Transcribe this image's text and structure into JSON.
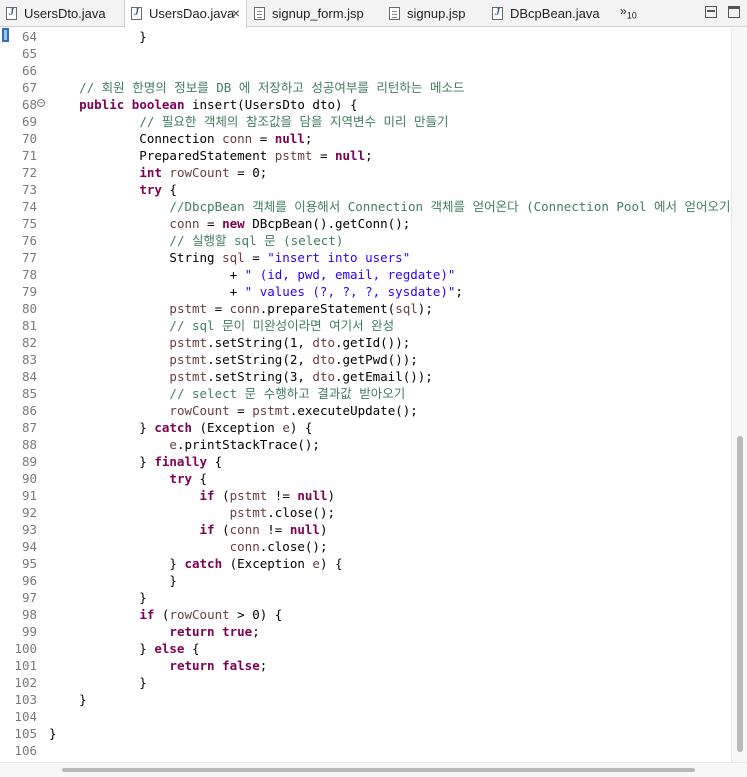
{
  "tabs": [
    {
      "label": "UsersDto.java",
      "icon": "java-file-icon",
      "active": false
    },
    {
      "label": "UsersDao.java",
      "icon": "java-file-icon",
      "active": true,
      "close": "×"
    },
    {
      "label": "signup_form.jsp",
      "icon": "jsp-file-icon",
      "active": false
    },
    {
      "label": "signup.jsp",
      "icon": "jsp-file-icon",
      "active": false
    },
    {
      "label": "DBcpBean.java",
      "icon": "java-file-icon",
      "active": false
    }
  ],
  "overflow": {
    "symbol": "»",
    "count": "10"
  },
  "editor": {
    "lines": [
      {
        "n": "64",
        "html": "            }"
      },
      {
        "n": "65",
        "html": ""
      },
      {
        "n": "66",
        "html": ""
      },
      {
        "n": "67",
        "html": "    <span class=\"cm\">// 회원 한명의 정보를 DB 에 저장하고 성공여부를 리턴하는 메소드</span>"
      },
      {
        "n": "68",
        "fold": true,
        "html": "    <span class=\"kw\">public</span> <span class=\"kw\">boolean</span> insert(UsersDto dto) {"
      },
      {
        "n": "69",
        "html": "            <span class=\"cm\">// 필요한 객체의 참조값을 담을 지역변수 미리 만들기</span>"
      },
      {
        "n": "70",
        "html": "            Connection <span class=\"var\">conn</span> = <span class=\"kw\">null</span>;"
      },
      {
        "n": "71",
        "html": "            PreparedStatement <span class=\"var\">pstmt</span> = <span class=\"kw\">null</span>;"
      },
      {
        "n": "72",
        "html": "            <span class=\"kw\">int</span> <span class=\"var\">rowCount</span> = 0;"
      },
      {
        "n": "73",
        "html": "            <span class=\"kw\">try</span> {"
      },
      {
        "n": "74",
        "html": "                <span class=\"cm\">//DbcpBean 객체를 이용해서 Connection 객체를 얻어온다 (Connection Pool 에서 얻어오기)</span>"
      },
      {
        "n": "75",
        "html": "                <span class=\"var\">conn</span> = <span class=\"kw\">new</span> DBcpBean().getConn();"
      },
      {
        "n": "76",
        "html": "                <span class=\"cm\">// 실행할 sql 문 (select)</span>"
      },
      {
        "n": "77",
        "html": "                String <span class=\"var\">sql</span> = <span class=\"st\">\"insert into users\"</span>"
      },
      {
        "n": "78",
        "html": "                        + <span class=\"st\">\" (id, pwd, email, regdate)\"</span>"
      },
      {
        "n": "79",
        "html": "                        + <span class=\"st\">\" values (?, ?, ?, sysdate)\"</span>;"
      },
      {
        "n": "80",
        "html": "                <span class=\"var\">pstmt</span> = <span class=\"var\">conn</span>.prepareStatement(<span class=\"var\">sql</span>);"
      },
      {
        "n": "81",
        "html": "                <span class=\"cm\">// sql 문이 미완성이라면 여기서 완성</span>"
      },
      {
        "n": "82",
        "html": "                <span class=\"var\">pstmt</span>.setString(1, <span class=\"var\">dto</span>.getId());"
      },
      {
        "n": "83",
        "html": "                <span class=\"var\">pstmt</span>.setString(2, <span class=\"var\">dto</span>.getPwd());"
      },
      {
        "n": "84",
        "html": "                <span class=\"var\">pstmt</span>.setString(3, <span class=\"var\">dto</span>.getEmail());"
      },
      {
        "n": "85",
        "html": "                <span class=\"cm\">// select 문 수행하고 결과값 받아오기</span>"
      },
      {
        "n": "86",
        "html": "                <span class=\"var\">rowCount</span> = <span class=\"var\">pstmt</span>.executeUpdate();"
      },
      {
        "n": "87",
        "html": "            } <span class=\"kw\">catch</span> (Exception <span class=\"var\">e</span>) {"
      },
      {
        "n": "88",
        "html": "                <span class=\"var\">e</span>.printStackTrace();"
      },
      {
        "n": "89",
        "html": "            } <span class=\"kw\">finally</span> {"
      },
      {
        "n": "90",
        "html": "                <span class=\"kw\">try</span> {"
      },
      {
        "n": "91",
        "html": "                    <span class=\"kw\">if</span> (<span class=\"var\">pstmt</span> != <span class=\"kw\">null</span>)"
      },
      {
        "n": "92",
        "html": "                        <span class=\"var\">pstmt</span>.close();"
      },
      {
        "n": "93",
        "html": "                    <span class=\"kw\">if</span> (<span class=\"var\">conn</span> != <span class=\"kw\">null</span>)"
      },
      {
        "n": "94",
        "html": "                        <span class=\"var\">conn</span>.close();"
      },
      {
        "n": "95",
        "html": "                } <span class=\"kw\">catch</span> (Exception <span class=\"var\">e</span>) {"
      },
      {
        "n": "96",
        "html": "                }"
      },
      {
        "n": "97",
        "html": "            }"
      },
      {
        "n": "98",
        "html": "            <span class=\"kw\">if</span> (<span class=\"var\">rowCount</span> &gt; 0) {"
      },
      {
        "n": "99",
        "html": "                <span class=\"kw\">return</span> <span class=\"kw\">true</span>;"
      },
      {
        "n": "100",
        "html": "            } <span class=\"kw\">else</span> {"
      },
      {
        "n": "101",
        "html": "                <span class=\"kw\">return</span> <span class=\"kw\">false</span>;"
      },
      {
        "n": "102",
        "html": "            }"
      },
      {
        "n": "103",
        "html": "    }"
      },
      {
        "n": "104",
        "html": ""
      },
      {
        "n": "105",
        "html": "}"
      },
      {
        "n": "106",
        "html": ""
      }
    ]
  }
}
